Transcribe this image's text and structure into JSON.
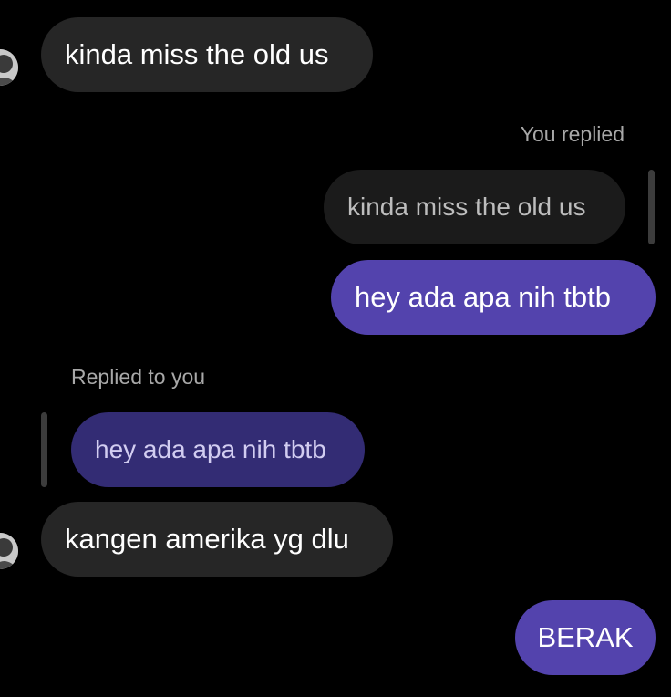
{
  "colors": {
    "background": "#000000",
    "incoming_bubble": "#262626",
    "outgoing_bubble": "#5343ad",
    "quoted_incoming": "#1b1b1b",
    "quoted_outgoing": "#332c74",
    "meta_text": "#a8a8a8"
  },
  "messages": [
    {
      "direction": "incoming",
      "text": "kinda miss the old us",
      "avatar": "avatar-icon"
    },
    {
      "direction": "outgoing",
      "reply_label": "You replied",
      "quoted_text": "kinda miss the old us",
      "text": "hey ada apa nih tbtb"
    },
    {
      "direction": "incoming",
      "reply_label": "Replied to you",
      "quoted_text": "hey ada apa nih tbtb",
      "text": "kangen amerika yg dlu",
      "avatar": "avatar-icon"
    },
    {
      "direction": "outgoing",
      "text": "BERAK"
    }
  ]
}
